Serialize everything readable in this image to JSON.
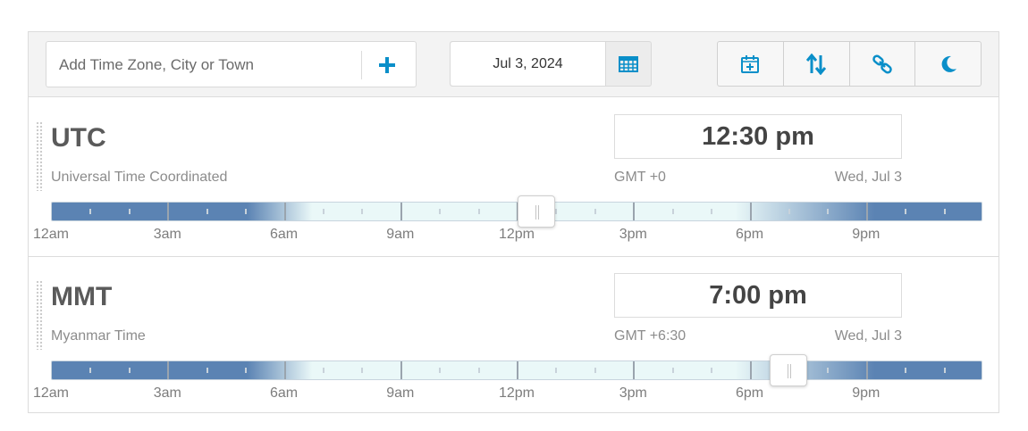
{
  "toolbar": {
    "search_placeholder": "Add Time Zone, City or Town",
    "add_icon": "plus-icon",
    "date": "Jul 3, 2024",
    "calendar_icon": "calendar-grid-icon",
    "tools": [
      {
        "name": "schedule-event-button",
        "icon": "calendar-plus-icon"
      },
      {
        "name": "sort-button",
        "icon": "sort-arrows-icon"
      },
      {
        "name": "link-button",
        "icon": "link-icon"
      },
      {
        "name": "dark-mode-button",
        "icon": "moon-icon"
      }
    ],
    "accent_color": "#0a8fc9"
  },
  "hour_labels": [
    "12am",
    "3am",
    "6am",
    "9am",
    "12pm",
    "3pm",
    "6pm",
    "9pm"
  ],
  "timezones": [
    {
      "abbr": "UTC",
      "name": "Universal Time Coordinated",
      "time": "12:30 pm",
      "offset": "GMT +0",
      "date": "Wed, Jul 3",
      "handle_hour": 12.5
    },
    {
      "abbr": "MMT",
      "name": "Myanmar Time",
      "time": "7:00 pm",
      "offset": "GMT +6:30",
      "date": "Wed, Jul 3",
      "handle_hour": 19
    }
  ],
  "colors": {
    "night": "#5b83b3",
    "day": "#eaf8f8"
  }
}
